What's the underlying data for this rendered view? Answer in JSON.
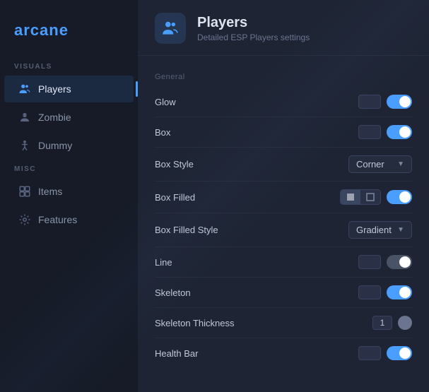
{
  "sidebar": {
    "logo": "arcane",
    "sections": [
      {
        "label": "VISUALS",
        "items": [
          {
            "id": "players",
            "label": "Players",
            "icon": "👥",
            "active": true
          },
          {
            "id": "zombie",
            "label": "Zombie",
            "icon": "💀",
            "active": false
          },
          {
            "id": "dummy",
            "label": "Dummy",
            "icon": "🧍",
            "active": false
          }
        ]
      },
      {
        "label": "MISC",
        "items": [
          {
            "id": "items",
            "label": "Items",
            "icon": "🧰",
            "active": false
          },
          {
            "id": "features",
            "label": "Features",
            "icon": "⚙️",
            "active": false
          }
        ]
      }
    ]
  },
  "header": {
    "icon": "👥",
    "title": "Players",
    "subtitle": "Detailed ESP Players settings"
  },
  "content": {
    "section_general": "General",
    "settings": [
      {
        "id": "glow",
        "label": "Glow",
        "type": "toggle_btn",
        "btn": true,
        "toggle": "on"
      },
      {
        "id": "box",
        "label": "Box",
        "type": "toggle_btn",
        "btn": true,
        "toggle": "on"
      },
      {
        "id": "box_style",
        "label": "Box Style",
        "type": "dropdown",
        "value": "Corner"
      },
      {
        "id": "box_filled",
        "label": "Box Filled",
        "type": "toggle_group_toggle",
        "toggle": "on"
      },
      {
        "id": "box_filled_style",
        "label": "Box Filled Style",
        "type": "dropdown",
        "value": "Gradient"
      },
      {
        "id": "line",
        "label": "Line",
        "type": "toggle_btn",
        "btn": true,
        "toggle": "gray"
      },
      {
        "id": "skeleton",
        "label": "Skeleton",
        "type": "toggle_btn",
        "btn": true,
        "toggle": "on"
      },
      {
        "id": "skeleton_thickness",
        "label": "Skeleton Thickness",
        "type": "num_toggle",
        "num": "1",
        "toggle": "dot"
      },
      {
        "id": "health_bar",
        "label": "Health Bar",
        "type": "toggle_btn",
        "btn": true,
        "toggle": "on"
      }
    ]
  }
}
